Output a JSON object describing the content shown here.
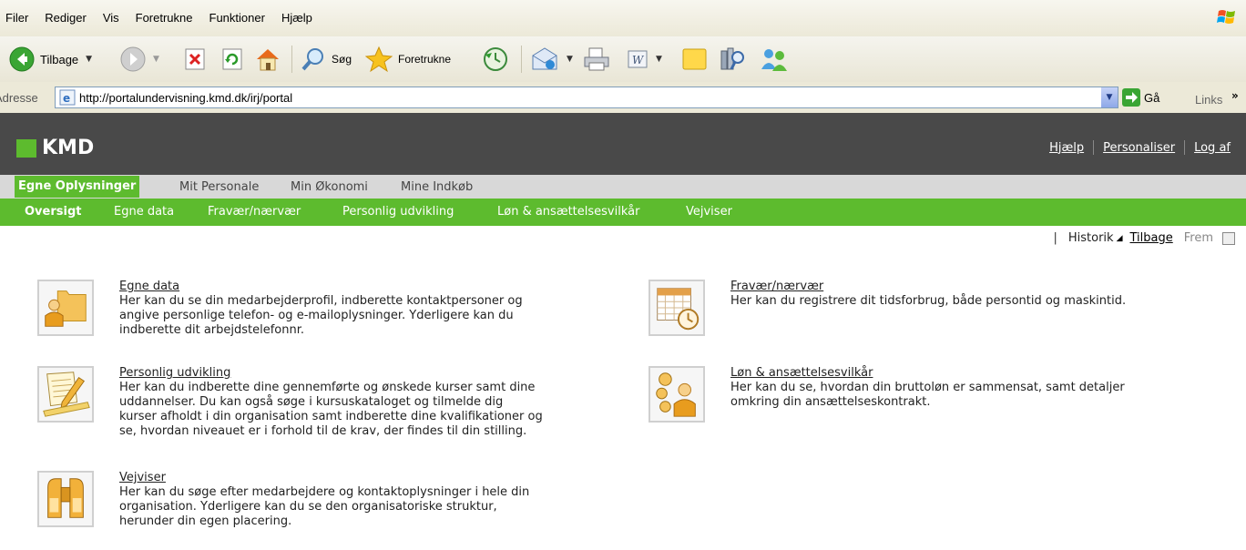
{
  "browser": {
    "menu": [
      "Filer",
      "Rediger",
      "Vis",
      "Foretrukne",
      "Funktioner",
      "Hjælp"
    ],
    "toolbar": {
      "back_label": "Tilbage",
      "search_label": "Søg",
      "favorites_label": "Foretrukne"
    },
    "address": {
      "label": "Adresse",
      "url": "http://portalundervisning.kmd.dk/irj/portal",
      "go_label": "Gå",
      "links_label": "Links"
    }
  },
  "portal": {
    "logo_text": "KMD",
    "header_links": {
      "help": "Hjælp",
      "personalize": "Personaliser",
      "logoff": "Log af"
    },
    "tabs_level1": [
      "Egne Oplysninger",
      "Mit Personale",
      "Min Økonomi",
      "Mine Indkøb"
    ],
    "tabs_level2": [
      "Oversigt",
      "Egne data",
      "Fravær/nærvær",
      "Personlig udvikling",
      "Løn & ansættelsesvilkår",
      "Vejviser"
    ],
    "history": {
      "pipe": "|",
      "history_label": "Historik",
      "back_label": "Tilbage",
      "forward_label": "Frem"
    },
    "items": [
      {
        "title": "Egne data",
        "lines": [
          "Her kan du se din medarbejderprofil, indberette kontaktpersoner og",
          "angive personlige telefon- og e-mailoplysninger. Yderligere kan du",
          "indberette dit arbejdstelefonnr."
        ]
      },
      {
        "title": "Fravær/nærvær",
        "lines": [
          "Her kan du registrere dit tidsforbrug, både persontid og maskintid."
        ]
      },
      {
        "title": "Personlig udvikling",
        "lines": [
          "Her kan du indberette dine gennemførte og ønskede kurser samt dine",
          "uddannelser. Du kan også søge i kursuskataloget og tilmelde dig",
          "kurser afholdt i din organisation samt indberette dine kvalifikationer og",
          "se, hvordan niveauet er i forhold til de krav, der findes til din stilling."
        ]
      },
      {
        "title": "Løn & ansættelsesvilkår",
        "lines": [
          "Her kan du se, hvordan din bruttoløn er sammensat, samt detaljer",
          "omkring din ansættelseskontrakt."
        ]
      },
      {
        "title": "Vejviser",
        "lines": [
          "Her kan du søge efter medarbejdere og kontaktoplysninger i hele din",
          "organisation. Yderligere kan du se den organisatoriske struktur,",
          "herunder din egen placering."
        ]
      }
    ]
  },
  "colors": {
    "accent": "#5dbb2e",
    "header_bg": "#494949"
  }
}
